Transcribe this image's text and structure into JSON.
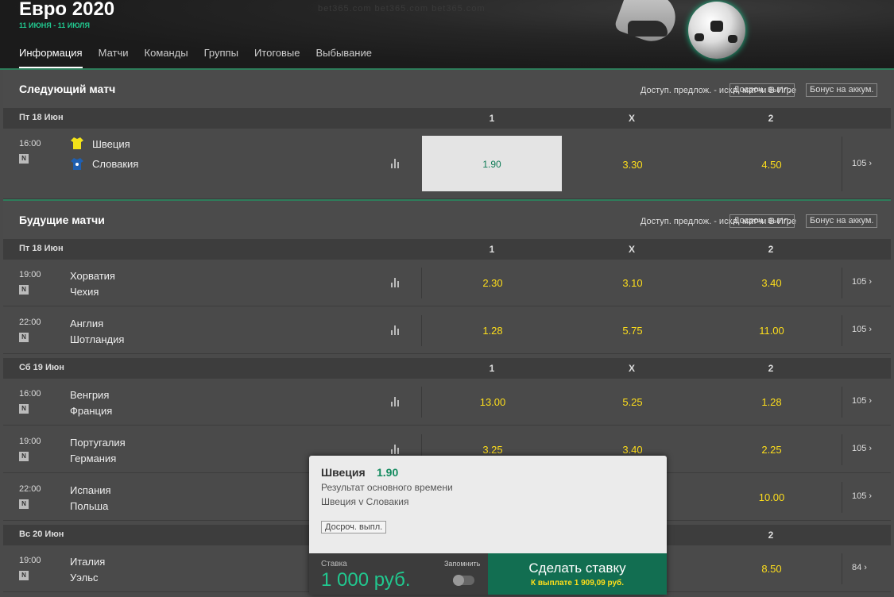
{
  "header": {
    "title": "Евро 2020",
    "dates": "11 ИЮНЯ - 11 ИЮЛЯ",
    "banner_text": "bet365.com   bet365.com   bet365.com",
    "tabs": [
      "Информация",
      "Матчи",
      "Команды",
      "Группы",
      "Итоговые",
      "Выбывание"
    ],
    "active_tab": 0
  },
  "sections": {
    "next": {
      "title": "Следующий матч",
      "filter": "Доступ. предлож. - искл. матчи В Игре",
      "cashout": "Досроч. выпл.",
      "acca_bonus": "Бонус на аккум."
    },
    "upcoming": {
      "title": "Будущие матчи",
      "filter": "Доступ. предлож. - искл. матчи В Игре",
      "cashout": "Досроч. выпл.",
      "acca_bonus": "Бонус на аккум."
    }
  },
  "columns": {
    "c1": "1",
    "cx": "X",
    "c2": "2"
  },
  "dates": {
    "next_d1": "Пт 18 Июн",
    "up_d1": "Пт 18 Июн",
    "up_d2": "Сб 19 Июн",
    "up_d3": "Вс 20 Июн"
  },
  "badge": "N",
  "matches": [
    {
      "time": "16:00",
      "home": "Швеция",
      "away": "Словакия",
      "o1": "1.90",
      "ox": "3.30",
      "o2": "4.50",
      "more": "105"
    },
    {
      "time": "19:00",
      "home": "Хорватия",
      "away": "Чехия",
      "o1": "2.30",
      "ox": "3.10",
      "o2": "3.40",
      "more": "105"
    },
    {
      "time": "22:00",
      "home": "Англия",
      "away": "Шотландия",
      "o1": "1.28",
      "ox": "5.75",
      "o2": "11.00",
      "more": "105"
    },
    {
      "time": "16:00",
      "home": "Венгрия",
      "away": "Франция",
      "o1": "13.00",
      "ox": "5.25",
      "o2": "1.28",
      "more": "105"
    },
    {
      "time": "19:00",
      "home": "Португалия",
      "away": "Германия",
      "o1": "3.25",
      "ox": "3.40",
      "o2": "2.25",
      "more": "105"
    },
    {
      "time": "22:00",
      "home": "Испания",
      "away": "Польша",
      "o1": "",
      "ox": "",
      "o2": "10.00",
      "more": "105"
    },
    {
      "time": "19:00",
      "home": "Италия",
      "away": "Уэльс",
      "o1": "",
      "ox": "",
      "o2": "8.50",
      "more": "84"
    }
  ],
  "betslip": {
    "selection": "Швеция",
    "odds": "1.90",
    "market": "Результат основного времени",
    "event": "Швеция v Словакия",
    "cashout": "Досроч. выпл.",
    "stake_label": "Ставка",
    "stake_value": "1 000 руб.",
    "remember_label": "Запомнить",
    "place_bet_label": "Сделать ставку",
    "payout": "К выплате 1 909,09 руб."
  },
  "colors": {
    "accent_green": "#21c88f",
    "odds_yellow": "#ffdf1b",
    "place_bet_bg": "#126e51"
  }
}
